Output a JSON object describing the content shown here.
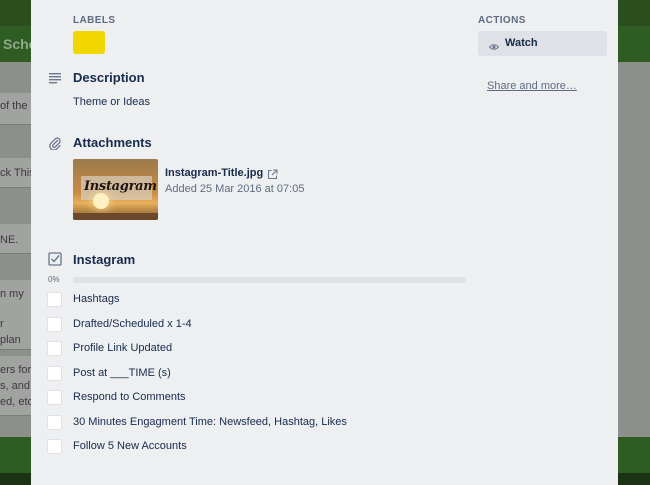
{
  "background": {
    "board_title": "Sche",
    "card_fragments": [
      "of the",
      "ck This",
      "NE.",
      "n my",
      "r",
      "plan",
      "ers for",
      "s, and",
      "ed, etc."
    ]
  },
  "card": {
    "labels": {
      "heading": "LABELS",
      "items": [
        {
          "color": "#f2d600"
        }
      ]
    },
    "description": {
      "heading": "Description",
      "text": "Theme or Ideas"
    },
    "attachments": {
      "heading": "Attachments",
      "items": [
        {
          "thumbnail_text": "Instagram",
          "name": "Instagram-Title.jpg",
          "added": "Added 25 Mar 2016 at 07:05"
        }
      ]
    },
    "checklist": {
      "title": "Instagram",
      "progress_label": "0%",
      "progress": 0,
      "items": [
        {
          "label": "Hashtags",
          "checked": false
        },
        {
          "label": "Drafted/Scheduled x 1-4",
          "checked": false
        },
        {
          "label": "Profile Link Updated",
          "checked": false
        },
        {
          "label": "Post at ___TIME (s)",
          "checked": false
        },
        {
          "label": "Respond to Comments",
          "checked": false
        },
        {
          "label": "30 Minutes Engagment Time: Newsfeed, Hashtag, Likes",
          "checked": false
        },
        {
          "label": "Follow 5 New Accounts",
          "checked": false
        }
      ]
    }
  },
  "sidebar": {
    "actions_heading": "ACTIONS",
    "watch_label": "Watch",
    "share_label": "Share and more…"
  },
  "colors": {
    "label_yellow": "#f2d600",
    "progress_green": "#61bd4f",
    "board_green": "#2a4e1d"
  },
  "icons": {
    "description": "text-lines-icon",
    "attachments": "paperclip-icon",
    "checklist": "checkbox-icon",
    "watch": "eye-icon",
    "external": "external-link-icon"
  }
}
